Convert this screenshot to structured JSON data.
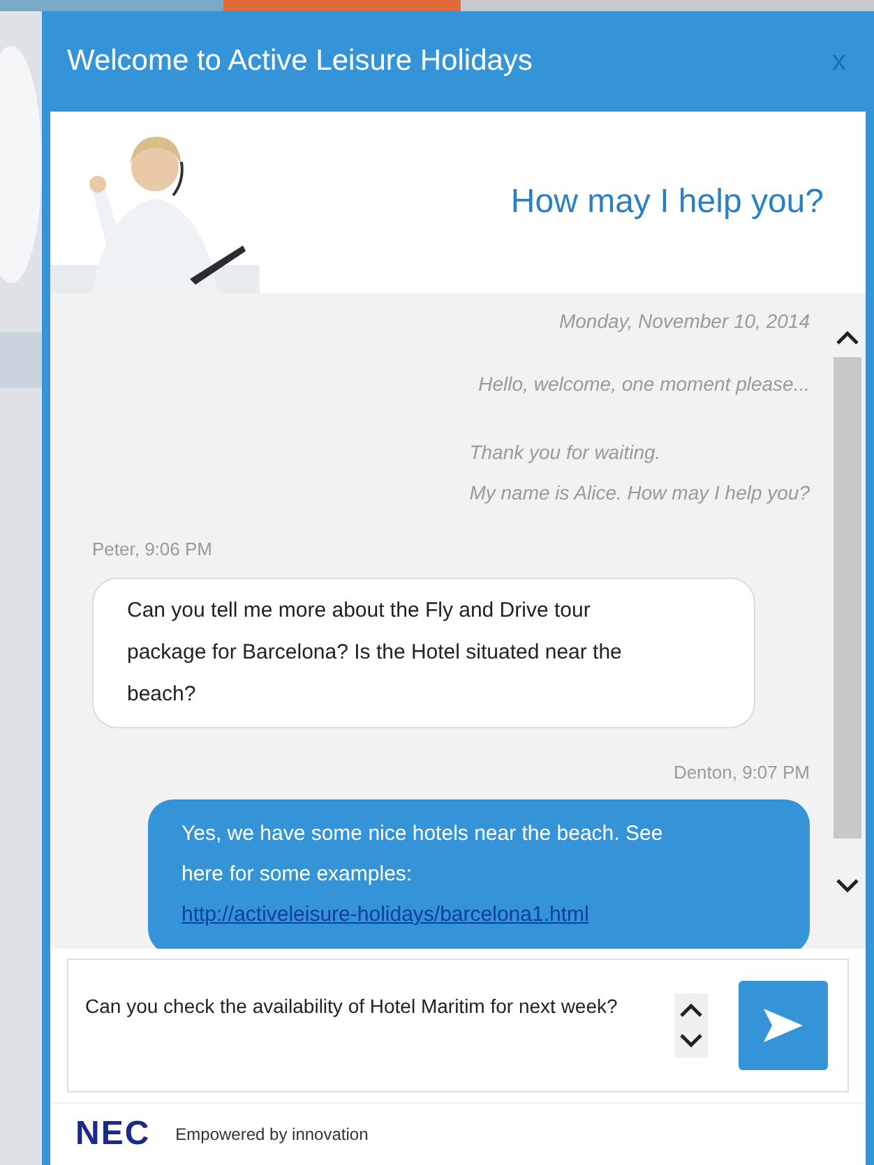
{
  "window": {
    "title": "Welcome to Active Leisure Holidays",
    "close": "x"
  },
  "banner": {
    "kind": "picture",
    "tagline": "How may I help you?"
  },
  "chat": {
    "date": "Monday, November 10, 2014",
    "system_messages": [
      {
        "lines": [
          "Hello, welcome, one moment please..."
        ]
      },
      {
        "lines": [
          "Thank you for waiting.",
          "My name is Alice. How may I help you?"
        ]
      }
    ],
    "messages": [
      {
        "kind": "incoming",
        "sender": "Peter, 9:06 PM",
        "text": "Can you tell me more about the Fly and Drive tour package for Barcelona? Is the Hotel situated near the beach?"
      },
      {
        "kind": "outgoing",
        "sender": "Denton, 9:07 PM",
        "text": "Yes, we have some nice hotels near the beach. See here for some examples:",
        "link": "http://activeleisure-holidays/barcelona1.html"
      }
    ]
  },
  "composer": {
    "value": "Can you check the availability of Hotel Maritim for next week?"
  },
  "footer": {
    "logo": "NEC",
    "slogan": "Empowered by innovation"
  }
}
